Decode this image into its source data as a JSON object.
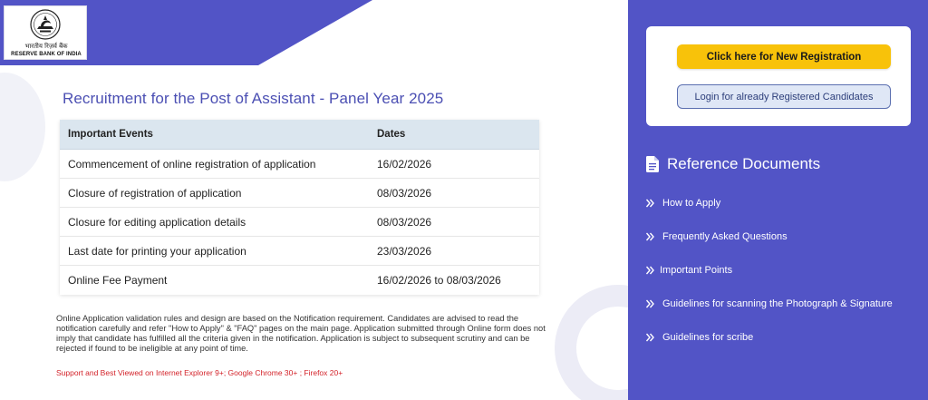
{
  "brand": {
    "hindi_name": "भारतीय रिज़र्व बैंक",
    "english_name": "RESERVE BANK OF INDIA",
    "logo_icon": "rbi-emblem-icon"
  },
  "colors": {
    "accent_purple": "#5254c6",
    "title_purple": "#4b4fb3",
    "primary_button": "#f8c20a",
    "warning_text": "#d3232a",
    "table_header": "#dbe6ef"
  },
  "main": {
    "title": "Recruitment for the Post of Assistant - Panel Year 2025",
    "table": {
      "headers": [
        "Important Events",
        "Dates"
      ],
      "rows": [
        {
          "event": "Commencement of online registration of application",
          "date": "16/02/2026"
        },
        {
          "event": "Closure of registration of application",
          "date": "08/03/2026"
        },
        {
          "event": "Closure for editing application details",
          "date": "08/03/2026"
        },
        {
          "event": "Last date for printing your application",
          "date": "23/03/2026"
        },
        {
          "event": "Online Fee Payment",
          "date": "16/02/2026 to 08/03/2026"
        }
      ]
    },
    "note": "Online Application validation rules and design are based on the Notification requirement. Candidates are advised to read the notification carefully and refer \"How to Apply\" & \"FAQ\" pages on the main page. Application submitted through Online form does not imply that candidate has fulfilled all the criteria given in the notification. Application is subject to subsequent scrutiny and can be rejected if found to be ineligible at any point of time.",
    "support": "Support and Best Viewed on Internet Explorer 9+; Google Chrome 30+ ; Firefox 20+"
  },
  "sidebar": {
    "new_registration_label": "Click here for New Registration",
    "login_label": "Login for already Registered Candidates",
    "reference_heading": "Reference Documents",
    "reference_icon": "document-icon",
    "items": [
      {
        "label": "How to Apply",
        "icon": "double-chevron-right-icon"
      },
      {
        "label": "Frequently Asked Questions",
        "icon": "double-chevron-right-icon"
      },
      {
        "label": "Important Points",
        "icon": "double-chevron-right-icon"
      },
      {
        "label": "Guidelines for scanning the Photograph & Signature",
        "icon": "double-chevron-right-icon"
      },
      {
        "label": "Guidelines for scribe",
        "icon": "double-chevron-right-icon"
      }
    ]
  }
}
